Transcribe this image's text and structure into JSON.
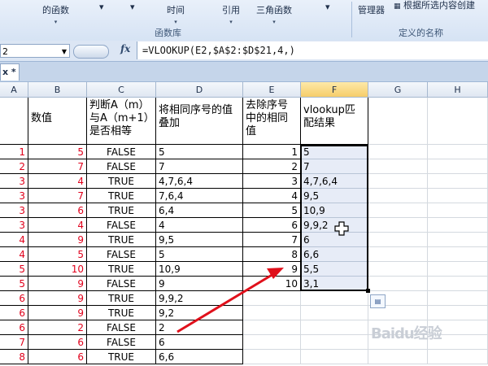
{
  "ribbon": {
    "buttons": [
      {
        "label": "的函数",
        "dd": "▾"
      },
      {
        "label": "▾",
        "dd": ""
      },
      {
        "label": "▾",
        "dd": ""
      },
      {
        "label": "时间",
        "dd": "▾"
      },
      {
        "label": "引用",
        "dd": "▾"
      },
      {
        "label": "三角函数",
        "dd": "▾"
      },
      {
        "label": "▾",
        "dd": ""
      },
      {
        "label": "管理器",
        "dd": ""
      },
      {
        "label": "根据所选内容创建",
        "dd": ""
      }
    ],
    "group_function_library": "函数库",
    "group_defined_names": "定义的名称"
  },
  "formula_bar": {
    "name_box": "2",
    "fx": "fx",
    "formula": "=VLOOKUP(E2,$A$2:$D$21,4,)"
  },
  "sheet_tab": "x *",
  "columns": [
    "A",
    "B",
    "C",
    "D",
    "E",
    "F",
    "G",
    "H"
  ],
  "headers": {
    "B": "数值",
    "C": "判断A（m）与A（m+1）是否相等",
    "D": "将相同序号的值叠加",
    "E": "去除序号中的相同值",
    "F": "vlookup匹配结果"
  },
  "rows": [
    {
      "a": "1",
      "b": "5",
      "c": "FALSE",
      "d": "5",
      "e": "1",
      "f": "5"
    },
    {
      "a": "2",
      "b": "7",
      "c": "FALSE",
      "d": "7",
      "e": "2",
      "f": "7"
    },
    {
      "a": "3",
      "b": "4",
      "c": "TRUE",
      "d": "4,7,6,4",
      "e": "3",
      "f": "4,7,6,4"
    },
    {
      "a": "3",
      "b": "7",
      "c": "TRUE",
      "d": "7,6,4",
      "e": "4",
      "f": "9,5"
    },
    {
      "a": "3",
      "b": "6",
      "c": "TRUE",
      "d": "6,4",
      "e": "5",
      "f": "10,9"
    },
    {
      "a": "3",
      "b": "4",
      "c": "FALSE",
      "d": "4",
      "e": "6",
      "f": "9,9,2"
    },
    {
      "a": "4",
      "b": "9",
      "c": "TRUE",
      "d": "9,5",
      "e": "7",
      "f": "6"
    },
    {
      "a": "4",
      "b": "5",
      "c": "FALSE",
      "d": "5",
      "e": "8",
      "f": "6,6"
    },
    {
      "a": "5",
      "b": "10",
      "c": "TRUE",
      "d": "10,9",
      "e": "9",
      "f": "5,5"
    },
    {
      "a": "5",
      "b": "9",
      "c": "FALSE",
      "d": "9",
      "e": "10",
      "f": "3,1"
    },
    {
      "a": "6",
      "b": "9",
      "c": "TRUE",
      "d": "9,9,2",
      "e": "",
      "f": ""
    },
    {
      "a": "6",
      "b": "9",
      "c": "TRUE",
      "d": "9,2",
      "e": "",
      "f": ""
    },
    {
      "a": "6",
      "b": "2",
      "c": "FALSE",
      "d": "2",
      "e": "",
      "f": ""
    },
    {
      "a": "7",
      "b": "6",
      "c": "FALSE",
      "d": "6",
      "e": "",
      "f": ""
    },
    {
      "a": "8",
      "b": "6",
      "c": "TRUE",
      "d": "6,6",
      "e": "",
      "f": ""
    }
  ],
  "watermark": "Baidu经验",
  "colors": {
    "accent_red": "#e0001b",
    "selection": "#e7ecf7",
    "ribbon": "#dce6f4"
  }
}
